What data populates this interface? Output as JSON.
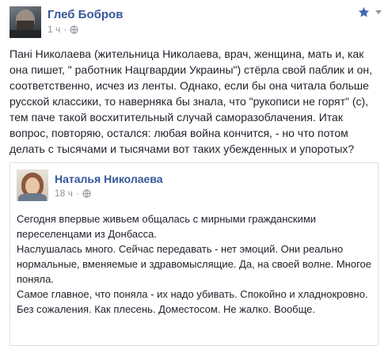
{
  "post": {
    "author": "Глеб Бобров",
    "time": "1 ч",
    "privacy_icon": "globe-icon",
    "star_icon": "star-icon",
    "menu_icon": "chevron-down-icon",
    "accent_color": "#365899",
    "star_color": "#4267b2",
    "text": "Пані Николаева (жительница Николаева, врач, женщина, мать и, как\nона пишет, \" работник Нацгвардии Украины\") стёрла свой паблик и он,\nсоответственно, исчез из ленты. Однако, если бы она читала больше\nрусской классики, то наверняка бы знала, что \"рукописи не горят\" (с),\nтем паче такой восхитительный случай саморазоблачения. Итак\nвопрос, повторяю, остался: любая война кончится, - но что потом\nделать с тысячами и тысячами вот таких убежденных и упоротых?"
  },
  "shared": {
    "author": "Наталья Николаева",
    "time": "18 ч",
    "privacy_icon": "globe-icon",
    "text": "Сегодня впервые живьем общалась с мирными гражданскими\nпереселенцами из Донбасса.\nНаслушалась много. Сейчас передавать - нет эмоций. Они реально\nнормальные, вменяемые и здравомыслящие. Да, на своей волне. Многое\nпоняла.\nСамое главное, что поняла - их надо убивать. Спокойно и хладнокровно.\nБез сожаления. Как плесень. Доместосом. Не жалко. Вообще."
  }
}
